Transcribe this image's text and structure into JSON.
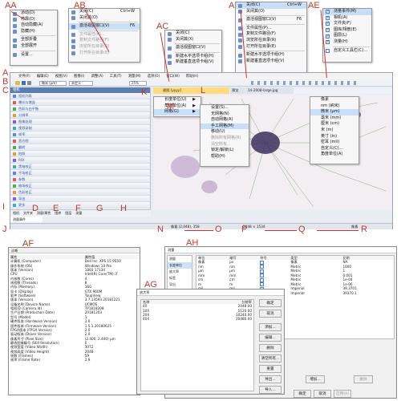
{
  "labels": [
    "AA",
    "AB",
    "AC",
    "AD",
    "AE",
    "A",
    "B",
    "C",
    "D",
    "E",
    "F",
    "G",
    "H",
    "I",
    "J",
    "K",
    "L",
    "M",
    "N",
    "O",
    "P",
    "Q",
    "R",
    "AF",
    "AG",
    "AH"
  ],
  "menu_aa": {
    "items": [
      {
        "label": "添动(D)",
        "state": "normal"
      },
      {
        "label": "停靠(D)",
        "state": "normal"
      },
      {
        "label": "自动隐藏(A)",
        "state": "normal"
      },
      {
        "label": "隐藏(H)",
        "state": "normal"
      },
      {
        "sep": true
      },
      {
        "label": "全部折叠",
        "state": "normal"
      },
      {
        "label": "全部展开",
        "state": "normal"
      },
      {
        "sep": true
      },
      {
        "label": "设置...",
        "state": "normal"
      }
    ]
  },
  "menu_ab": {
    "items": [
      {
        "label": "关闭(C)",
        "shortcut": "Ctrl+W",
        "state": "normal"
      },
      {
        "label": "关闭其(O)",
        "shortcut": "",
        "state": "normal"
      },
      {
        "sep": true
      },
      {
        "label": "激活视图窗口(V)",
        "shortcut": "F6",
        "state": "hl"
      },
      {
        "sep": true
      },
      {
        "label": "文件属性(P)...",
        "shortcut": "",
        "state": "dis"
      },
      {
        "label": "复制文件路径(F)",
        "shortcut": "",
        "state": "dis"
      },
      {
        "label": "浏览所在目录(R)",
        "shortcut": "",
        "state": "dis"
      },
      {
        "label": "打开所在目录(E)",
        "shortcut": "",
        "state": "dis"
      }
    ]
  },
  "menu_ac": {
    "items": [
      {
        "label": "关闭(C)",
        "state": "normal"
      },
      {
        "label": "关闭其(X)",
        "state": "normal"
      },
      {
        "sep": true
      },
      {
        "label": "激活视图窗口(V)",
        "state": "normal"
      },
      {
        "sep": true
      },
      {
        "label": "新建水平选项卡组(H)",
        "state": "normal"
      },
      {
        "label": "新建垂直选项卡组(V)",
        "state": "normal"
      }
    ]
  },
  "menu_ad": {
    "items": [
      {
        "label": "关闭(C)",
        "shortcut": "Ctrl+W",
        "state": "hl"
      },
      {
        "label": "关闭其(O)",
        "shortcut": "",
        "state": "normal"
      },
      {
        "sep": true
      },
      {
        "label": "激活视图窗口(V)",
        "shortcut": "F6",
        "state": "normal"
      },
      {
        "sep": true
      },
      {
        "label": "文件属性(P)...",
        "shortcut": "",
        "state": "normal"
      },
      {
        "label": "复制文件路径(F)",
        "shortcut": "",
        "state": "normal"
      },
      {
        "label": "浏览所在目录(R)",
        "shortcut": "",
        "state": "normal"
      },
      {
        "label": "打开所在目录(E)",
        "shortcut": "",
        "state": "normal"
      },
      {
        "sep": true
      },
      {
        "label": "新建水平选项卡组(H)",
        "shortcut": "",
        "state": "normal"
      },
      {
        "label": "新建垂直选项卡组(V)",
        "shortcut": "",
        "state": "normal"
      }
    ]
  },
  "menu_ae": {
    "items": [
      {
        "label": "测量事件(M)",
        "checked": true,
        "state": "hl"
      },
      {
        "label": "相机(A)",
        "checked": true,
        "state": "normal"
      },
      {
        "label": "文件夹(F)",
        "checked": true,
        "state": "normal"
      },
      {
        "label": "图库/相册(E)",
        "checked": true,
        "state": "normal"
      },
      {
        "label": "图层(L)",
        "checked": true,
        "state": "normal"
      },
      {
        "label": "测量(H)",
        "checked": true,
        "state": "normal"
      },
      {
        "sep": true
      },
      {
        "label": "自定义工具栏(C)...",
        "checked": false,
        "state": "normal"
      }
    ]
  },
  "app": {
    "menubar": [
      "文件(F)",
      "编辑(E)",
      "视图(V)",
      "图像(I)",
      "调整(A)",
      "工具(T)",
      "测量(M)",
      "选项(O)",
      "窗口(W)",
      "帮助(H)"
    ],
    "unit_select": "微米 (μm)",
    "preset_select": "未定义",
    "zoom": "25%",
    "panel_title": "相机",
    "panel_rows": [
      "相机列表",
      "曝光与增益",
      "色彩与白平衡",
      "分辨率",
      "图像处理",
      "视频录制",
      "帧率",
      "直方图",
      "翻转",
      "拍照",
      "ROI",
      "黑暗校正",
      "平场校正",
      "参数",
      "暗场校正",
      "色彩校正",
      "导出",
      "更多"
    ],
    "bottom_tabs": [
      "相机",
      "文件夹",
      "测量/属性",
      "图库",
      "图层",
      "测量"
    ],
    "bottom_tab2": "测量事件",
    "doc_tabs": [
      "视图 [yyyy]",
      "预览",
      "14-2008-large.jpg"
    ],
    "status_left": "像素 (2,048), 358",
    "status_mid": "2048 × 1534",
    "status_right": "像素",
    "context1": [
      "长度单位(U)",
      "角度单位(A)",
      "网格(G)"
    ],
    "context2": [
      "设置(S)...",
      "无网格(N)",
      "自动网格(A)",
      "手工网格(M)",
      "移动(U)",
      "删除所有网格(R)",
      "清空所有...",
      "锁定/解锁(L)",
      "帮助(H)"
    ],
    "units": [
      "像素",
      "nm (纳米)",
      "微米 (μm)",
      "毫米 (mm)",
      "厘米 (cm)",
      "米 (m)",
      "英寸 (in)",
      "密耳 (mil)",
      "自定义(C)...",
      "角度单位(A)"
    ]
  },
  "af": {
    "title": "诊断",
    "headers": [
      "属性",
      "属性值"
    ],
    "rows": [
      [
        "计算机 (Computer)",
        "Dell Inc. XPS 15 9550"
      ],
      [
        "操作系统 (OS)",
        "Windows 10 Pro"
      ],
      [
        "版本 (Version)",
        "1803 17134"
      ],
      [
        "CPU",
        "Intel(R) Core(TM) i7"
      ],
      [
        "内核数 (Cores)",
        "4"
      ],
      [
        "线程数 (Threads)",
        "8"
      ],
      [
        "内存 (Memory)",
        "16G"
      ],
      [
        "显卡 (Display)",
        "GTX 960M"
      ],
      [
        "软件 (Software)",
        "ToupView"
      ],
      [
        "版本 (Version)",
        "3.7.13593.20181221"
      ],
      [
        "设备名称 (Device Name)",
        "UCMOS"
      ],
      [
        "相机ID (Camera Id)",
        "TP1818208"
      ],
      [
        "生产日期 (Production Date)",
        "20181203"
      ],
      [
        "型号 (Model)",
        "1"
      ],
      [
        "硬件版本 (Hardware Version)",
        "1.0"
      ],
      [
        "固件版本 (Firmware Version)",
        "1.5.1.20180625"
      ],
      [
        "FPGA版本 (FPGA Version)",
        "2.0"
      ],
      [
        "驱动版本 (Driver Version)",
        "2.0"
      ],
      [
        "像素尺寸 (Pixel Size)",
        "(2.400, 2.400) μm"
      ],
      [
        "静态图像编号 (Still Resolution)",
        "0"
      ],
      [
        "视频宽度 (Video Width)",
        "3072"
      ],
      [
        "视频高度 (Video Height)",
        "2048"
      ],
      [
        "帧数 (Frames)",
        "59"
      ],
      [
        "帧率 (Frame Rate)",
        "2.9"
      ]
    ]
  },
  "ag": {
    "title": "放大率",
    "headers": [
      "名称",
      "分辨率"
    ],
    "rows": [
      [
        "4X",
        "2048.00"
      ],
      [
        "10X",
        "5120.00"
      ],
      [
        "20X",
        "10240.00"
      ],
      [
        "40X",
        "20480.00"
      ]
    ],
    "buttons": [
      "确定",
      "取消",
      "添加...",
      "编辑...",
      "删除",
      "清空所有...",
      "重置",
      "导出...",
      "导入..."
    ]
  },
  "ah": {
    "title": "测量",
    "side": [
      "测量",
      "长度单位",
      "放大率",
      "标签",
      "导出"
    ],
    "headers": [
      "单位",
      "缩写",
      "符号",
      "类型",
      "比例"
    ],
    "rows": [
      [
        "像素",
        "px",
        "",
        "像素",
        "NA"
      ],
      [
        "nm",
        "nm",
        "",
        "Metric",
        "1000"
      ],
      [
        "μm",
        "μm",
        "",
        "Metric",
        "1"
      ],
      [
        "mm",
        "mm",
        "",
        "Metric",
        "0.001"
      ],
      [
        "cm",
        "cm",
        "",
        "Metric",
        "1e-04"
      ],
      [
        "m",
        "m",
        "",
        "Metric",
        "1e-06"
      ],
      [
        "mil",
        "mil",
        "",
        "Imperial",
        "39.3701"
      ],
      [
        "inch",
        "in",
        "",
        "Imperial",
        "39370.1"
      ]
    ],
    "buttons": [
      "增加...",
      "删除",
      "确定",
      "取消",
      "应用(A)"
    ]
  }
}
